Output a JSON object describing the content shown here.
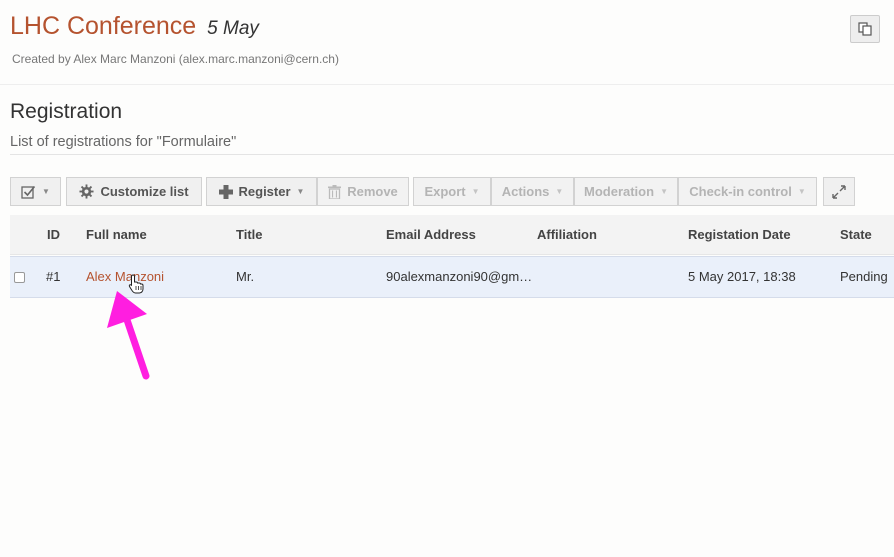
{
  "event": {
    "title": "LHC Conference",
    "date": "5 May",
    "created_by": "Created by Alex Marc Manzoni (alex.marc.manzoni@cern.ch)"
  },
  "section": {
    "title": "Registration",
    "subtitle": "List of registrations for \"Formulaire\""
  },
  "toolbar": {
    "customize_label": "Customize list",
    "register_label": "Register",
    "remove_label": "Remove",
    "export_label": "Export",
    "actions_label": "Actions",
    "moderation_label": "Moderation",
    "checkin_label": "Check-in control"
  },
  "table": {
    "columns": [
      "ID",
      "Full name",
      "Title",
      "Email Address",
      "Affiliation",
      "Registation Date",
      "State"
    ],
    "rows": [
      {
        "id": "#1",
        "full_name": "Alex Manzoni",
        "title": "Mr.",
        "email": "90alexmanzoni90@gm…",
        "affiliation": "",
        "date": "5 May 2017, 18:38",
        "state": "Pending"
      }
    ]
  },
  "colors": {
    "accent": "#b5532f",
    "annotation_arrow": "#ff1ee0",
    "row_highlight": "#eaf0fa"
  }
}
